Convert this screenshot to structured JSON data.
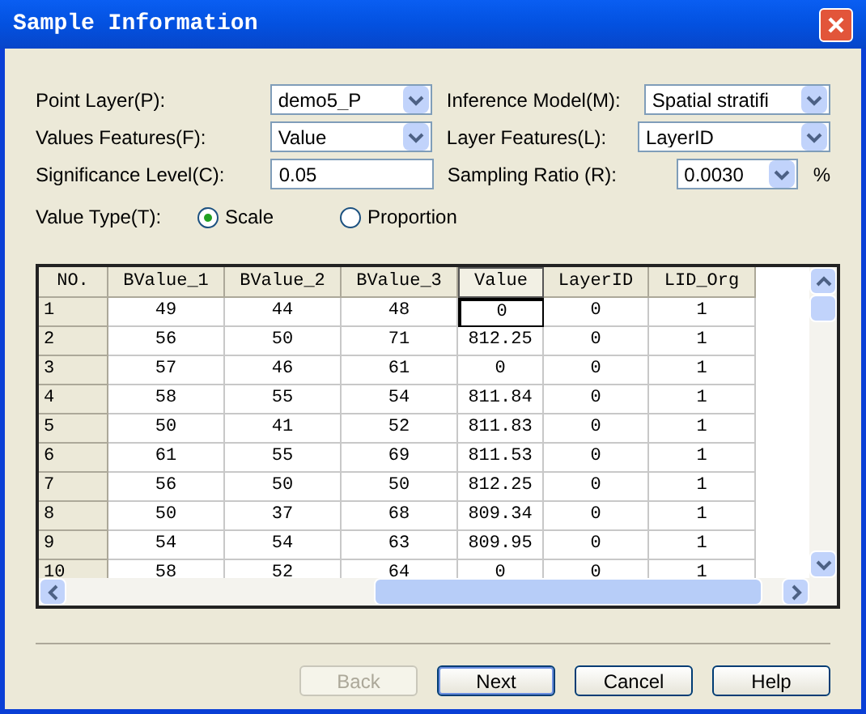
{
  "window": {
    "title": "Sample Information"
  },
  "form": {
    "point_layer": {
      "label": "Point Layer(P):",
      "value": "demo5_P"
    },
    "inference_model": {
      "label": "Inference Model(M):",
      "value": "Spatial stratifi"
    },
    "values_features": {
      "label": "Values Features(F):",
      "value": "Value"
    },
    "layer_features": {
      "label": "Layer Features(L):",
      "value": "LayerID"
    },
    "significance_level": {
      "label": "Significance Level(C):",
      "value": "0.05"
    },
    "sampling_ratio": {
      "label": "Sampling Ratio (R):",
      "value": "0.0030",
      "unit": "%"
    },
    "value_type": {
      "label": "Value Type(T):",
      "options": [
        {
          "label": "Scale",
          "selected": true
        },
        {
          "label": "Proportion",
          "selected": false
        }
      ]
    }
  },
  "table": {
    "columns": [
      {
        "label": "NO.",
        "focused": false
      },
      {
        "label": "BValue_1",
        "focused": false
      },
      {
        "label": "BValue_2",
        "focused": false
      },
      {
        "label": "BValue_3",
        "focused": false
      },
      {
        "label": "Value",
        "focused": true
      },
      {
        "label": "LayerID",
        "focused": false
      },
      {
        "label": "LID_Org",
        "focused": false
      }
    ],
    "rows": [
      {
        "focused": true,
        "cells": [
          "1",
          "49",
          "44",
          "48",
          "0",
          "0",
          "1"
        ]
      },
      {
        "focused": false,
        "cells": [
          "2",
          "56",
          "50",
          "71",
          "812.25",
          "0",
          "1"
        ]
      },
      {
        "focused": false,
        "cells": [
          "3",
          "57",
          "46",
          "61",
          "0",
          "0",
          "1"
        ]
      },
      {
        "focused": false,
        "cells": [
          "4",
          "58",
          "55",
          "54",
          "811.84",
          "0",
          "1"
        ]
      },
      {
        "focused": false,
        "cells": [
          "5",
          "50",
          "41",
          "52",
          "811.83",
          "0",
          "1"
        ]
      },
      {
        "focused": false,
        "cells": [
          "6",
          "61",
          "55",
          "69",
          "811.53",
          "0",
          "1"
        ]
      },
      {
        "focused": false,
        "cells": [
          "7",
          "56",
          "50",
          "50",
          "812.25",
          "0",
          "1"
        ]
      },
      {
        "focused": false,
        "cells": [
          "8",
          "50",
          "37",
          "68",
          "809.34",
          "0",
          "1"
        ]
      },
      {
        "focused": false,
        "cells": [
          "9",
          "54",
          "54",
          "63",
          "809.95",
          "0",
          "1"
        ]
      },
      {
        "focused": false,
        "cells": [
          "10",
          "58",
          "52",
          "64",
          "0",
          "0",
          "1"
        ]
      }
    ]
  },
  "buttons": [
    {
      "label": "Back",
      "disabled": true,
      "default": false
    },
    {
      "label": "Next",
      "disabled": false,
      "default": true
    },
    {
      "label": "Cancel",
      "disabled": false,
      "default": false
    },
    {
      "label": "Help",
      "disabled": false,
      "default": false
    }
  ]
}
